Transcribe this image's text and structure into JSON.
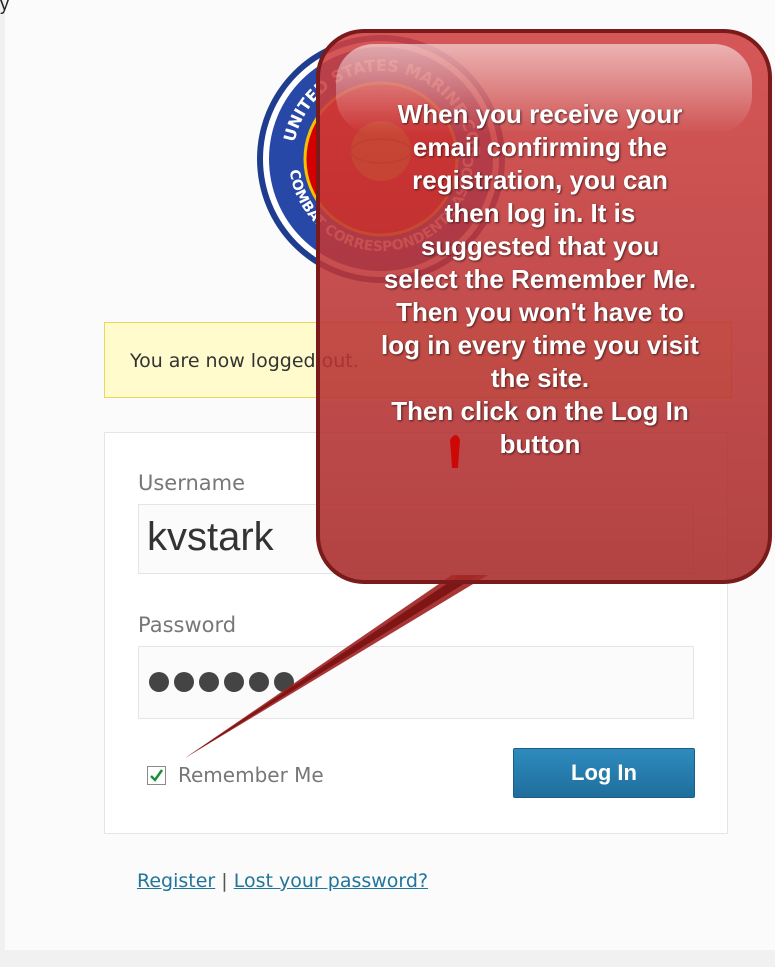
{
  "top_fragment": "y",
  "message": {
    "text": "You are now logged out."
  },
  "form": {
    "username_label": "Username",
    "username_value": "kvstark",
    "password_label": "Password",
    "password_dots": 6,
    "remember_label": "Remember Me",
    "remember_checked": true,
    "login_label": "Log In"
  },
  "nav": {
    "register": "Register",
    "separator": "|",
    "lost_password": "Lost your password?"
  },
  "logo": {
    "text_top": "UNITED STATES MARINE CORPS",
    "text_bottom": "COMBAT CORRESPONDENTS ASSOCIATION"
  },
  "callout": {
    "text": "When you receive your\nemail confirming the\nregistration, you can\nthen log in. It is\nsuggested that you\nselect the Remember Me.\nThen you won't have to\nlog in every time you visit\nthe site.\nThen click on the Log In\nbutton"
  },
  "colors": {
    "callout_fill": "#c94b4b",
    "message_bg": "#fffbcc",
    "button_bg": "#2e8bbd",
    "link": "#21759b"
  }
}
